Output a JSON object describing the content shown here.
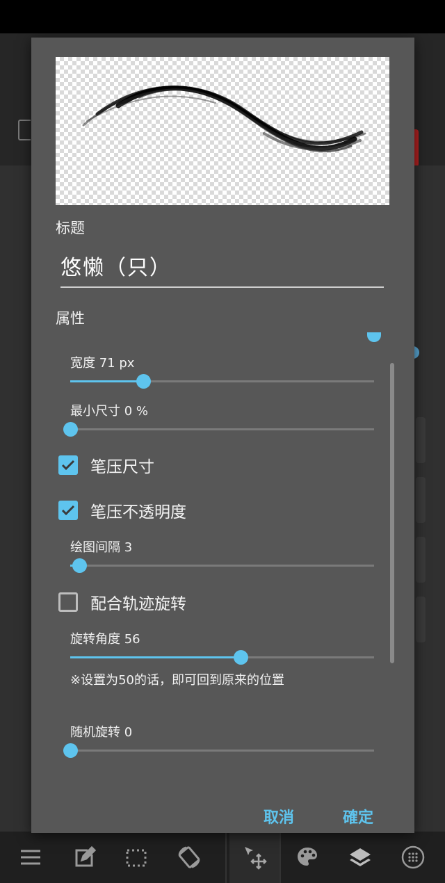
{
  "dialog": {
    "title_label": "标题",
    "title_value": "悠懒（只）",
    "properties_label": "属性",
    "cancel_label": "取消",
    "ok_label": "確定"
  },
  "properties": {
    "width": {
      "label": "宽度 71 px",
      "level": 0.24
    },
    "min_size": {
      "label": "最小尺寸  0  %",
      "level": 0.0
    },
    "pressure_size": {
      "label": "笔压尺寸",
      "checked": true
    },
    "pressure_opacity": {
      "label": "笔压不透明度",
      "checked": true
    },
    "spacing": {
      "label": "绘图间隔 3",
      "level": 0.03
    },
    "rotate_with_stroke": {
      "label": "配合轨迹旋转",
      "checked": false
    },
    "rotation_angle": {
      "label": "旋转角度 56",
      "level": 0.56,
      "note": "※设置为50的话，即可回到原来的位置"
    },
    "random_rotation": {
      "label": "随机旋转  0",
      "level": 0.0
    }
  },
  "bottom_toolbar": {
    "icons": [
      "menu-icon",
      "edit-icon",
      "selection-icon",
      "rotate-icon",
      "move-icon",
      "palette-icon",
      "layers-icon",
      "grid-icon"
    ],
    "active": "move-icon"
  },
  "colors": {
    "accent": "#5ec4ee",
    "dialog_bg": "#575757",
    "text": "#f0f0f0"
  }
}
